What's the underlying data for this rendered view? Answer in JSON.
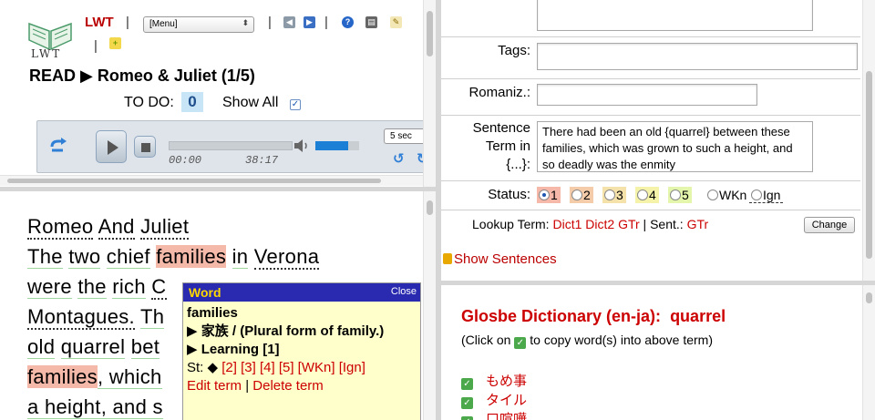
{
  "header": {
    "logo_text": "LWT",
    "app_name": "LWT",
    "menu_select": "[Menu]",
    "read_label": "READ ▶ Romeo & Juliet (1/5)",
    "todo_label": "TO DO:",
    "todo_count": "0",
    "show_all_label": "Show All"
  },
  "player": {
    "elapsed": "00:00",
    "duration": "38:17",
    "skip_select": "5 sec",
    "volume_level": 0.75,
    "progress_level": 0
  },
  "reading_text": {
    "title_words": [
      "Romeo",
      "And",
      "Juliet"
    ],
    "line1": [
      "The",
      "two",
      "chief",
      "families",
      "in",
      "Verona"
    ],
    "line2": [
      "were",
      "the",
      "rich",
      "C"
    ],
    "line3": [
      "Montagues.",
      "Th"
    ],
    "line4": [
      "old",
      "quarrel",
      "bet"
    ],
    "line5": [
      "families",
      ", which"
    ],
    "line6": [
      "a height, and s"
    ]
  },
  "popup": {
    "title": "Word",
    "close_label": "Close",
    "term": "families",
    "translation": "▶ 家族 / (Plural form of family.)",
    "status_text": "▶ Learning [1]",
    "st_label": "St:",
    "st_current": "◆",
    "st_links": [
      "[2]",
      "[3]",
      "[4]",
      "[5]",
      "[WKn]",
      "[Ign]"
    ],
    "edit_link": "Edit term",
    "delete_link": "Delete term"
  },
  "term_form": {
    "tags_label": "Tags:",
    "romaniz_label": "Romaniz.:",
    "sentence_label_1": "Sentence",
    "sentence_label_2": "Term in",
    "sentence_label_3": "{...}:",
    "sentence_value": "There had been an old {quarrel} between these families, which was grown to such a height, and so deadly was the enmity",
    "status_label": "Status:",
    "status_options": [
      "1",
      "2",
      "3",
      "4",
      "5",
      "WKn",
      "Ign"
    ],
    "status_colors": [
      "#f5b8a9",
      "#f5ccaa",
      "#f5e1aa",
      "#f5f3aa",
      "#e4f5ac",
      "#ffffff",
      "#ffffff"
    ],
    "lookup_label": "Lookup Term:",
    "lookup_links": [
      "Dict1",
      "Dict2",
      "GTr"
    ],
    "sent_label": "Sent.:",
    "sent_link": "GTr",
    "change_button": "Change",
    "show_sentences": "Show Sentences"
  },
  "dictionary": {
    "title": "Glosbe Dictionary (en-ja):",
    "query": "quarrel",
    "instruction_pre": "(Click on",
    "instruction_post": "to copy word(s) into above term)",
    "results": [
      "もめ事",
      "タイル",
      "口喧嘩"
    ]
  },
  "colors": {
    "accent_red": "#cc0000",
    "learning_highlight": "#f5b9aa",
    "popup_header": "#2a2ab0"
  }
}
